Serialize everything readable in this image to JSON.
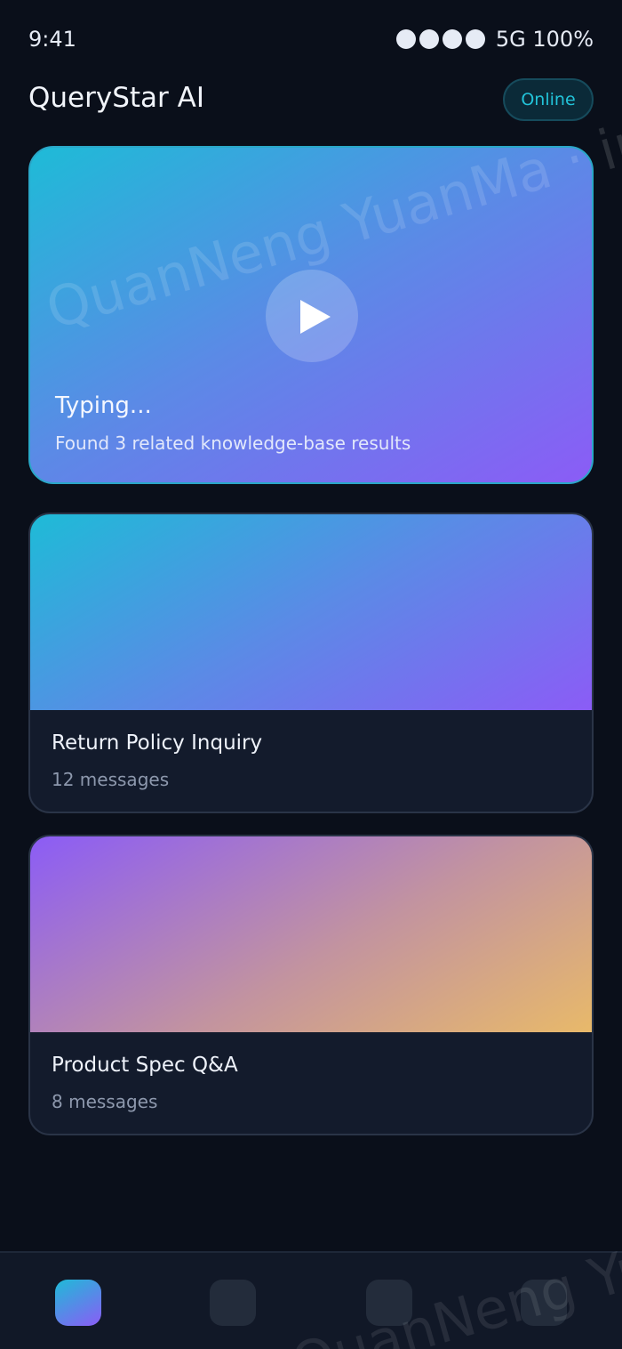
{
  "status_bar": {
    "time": "9:41",
    "network": "5G 100%"
  },
  "header": {
    "app_title": "QueryStar AI",
    "status_badge": "Online"
  },
  "hero": {
    "title": "Typing...",
    "subtitle": "Found 3 related knowledge-base results"
  },
  "conversations": [
    {
      "title": "Return Policy Inquiry",
      "meta": "12 messages"
    },
    {
      "title": "Product Spec Q&A",
      "meta": "8 messages"
    }
  ],
  "watermark": {
    "text": "QuanNeng YuanMa · inc",
    "text2": "QuanNeng YuanMa"
  },
  "colors": {
    "background": "#0a0f1a",
    "accent_cyan": "#22c3d9",
    "accent_purple": "#8b5cf6",
    "accent_amber": "#e8b96a",
    "card_surface": "#131b2c"
  },
  "icons": {
    "play": "play-icon",
    "signal": "signal-dot-icon"
  }
}
